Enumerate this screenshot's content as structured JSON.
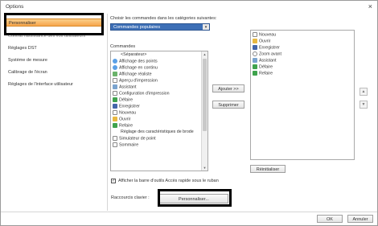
{
  "window": {
    "title": "Options",
    "close_glyph": "×"
  },
  "sidebar": {
    "items": [
      {
        "label": "Personnaliser",
        "selected": true
      },
      {
        "label": "Contrat l'assistance des vos utilisateurs",
        "selected": false
      },
      {
        "label": "Réglages DST",
        "selected": false
      },
      {
        "label": "Système de mesure",
        "selected": false
      },
      {
        "label": "Calibrage de l'écran",
        "selected": false
      },
      {
        "label": "Réglages de l'interface utilisateur",
        "selected": false
      }
    ]
  },
  "main": {
    "choose_label": "Choisir les commandes dans les catégories suivantes:",
    "category_select": {
      "value": "Commandes populaires",
      "chevron": "▾"
    },
    "commands_label": "Commandes",
    "commands": [
      {
        "label": "<Séparateur>",
        "icon": "separator-icon",
        "color": "#ffffff"
      },
      {
        "label": "Affichage des points",
        "icon": "points-icon",
        "color": "#5aa0e6"
      },
      {
        "label": "Affichage en continu",
        "icon": "continuous-icon",
        "color": "#5aa0e6"
      },
      {
        "label": "Affichage réaliste",
        "icon": "realistic-icon",
        "color": "#6bb36b"
      },
      {
        "label": "Aperçu d'impression",
        "icon": "print-preview-icon",
        "color": "#888888"
      },
      {
        "label": "Assistant",
        "icon": "assistant-icon",
        "color": "#7aa4cf"
      },
      {
        "label": "Configuration d'impression",
        "icon": "print-setup-icon",
        "color": "#888888"
      },
      {
        "label": "Défaire",
        "icon": "undo-icon",
        "color": "#3fa34d"
      },
      {
        "label": "Enregistrer",
        "icon": "save-icon",
        "color": "#4466aa"
      },
      {
        "label": "Nouveau",
        "icon": "new-icon",
        "color": "#ffffff"
      },
      {
        "label": "Ouvrir",
        "icon": "open-icon",
        "color": "#e8b840"
      },
      {
        "label": "Refaire",
        "icon": "redo-icon",
        "color": "#3fa34d"
      },
      {
        "label": "Réglage des caractéristiques de brode",
        "icon": "embroidery-settings-icon",
        "color": "#ffffff"
      },
      {
        "label": "Simulateur de point",
        "icon": "stitch-simulator-icon",
        "color": "#888888"
      },
      {
        "label": "Sommaire",
        "icon": "summary-icon",
        "color": "#888888"
      }
    ],
    "add_button": "Ajouter >>",
    "remove_button": "Supprimer",
    "toolbar_items": [
      {
        "label": "Nouveau",
        "icon": "new-icon",
        "color": "#ffffff"
      },
      {
        "label": "Ouvrir",
        "icon": "open-icon",
        "color": "#e8b840"
      },
      {
        "label": "Enregistrer",
        "icon": "save-icon",
        "color": "#4466aa"
      },
      {
        "label": "Zoom avant",
        "icon": "zoom-in-icon",
        "color": "#888888"
      },
      {
        "label": "Assistant",
        "icon": "assistant-icon",
        "color": "#7aa4cf"
      },
      {
        "label": "Défaire",
        "icon": "undo-icon",
        "color": "#3fa34d"
      },
      {
        "label": "Refaire",
        "icon": "redo-icon",
        "color": "#3fa34d"
      }
    ],
    "move_up_glyph": "▲",
    "move_down_glyph": "▼",
    "reset_button": "Réinitialiser",
    "show_below_checkbox": {
      "label": "Afficher la barre d'outils Accès rapide sous le ruban",
      "checked": true,
      "glyph": "✓"
    },
    "keyboard_label": "Raccourcis clavier :",
    "customize_button": "Personnaliser..."
  },
  "footer": {
    "ok_button": "OK",
    "cancel_button": "Annuler"
  },
  "colors": {
    "selected_item": "#f6a54b",
    "combo_bg": "#3d6fb6"
  }
}
